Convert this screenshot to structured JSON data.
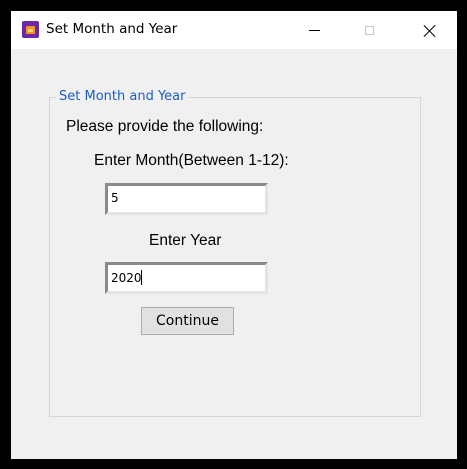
{
  "window": {
    "title": "Set Month and Year",
    "app_icon": "app-icon",
    "controls": {
      "minimize_icon": "minimize-icon",
      "maximize_icon": "maximize-icon",
      "close_icon": "close-icon"
    }
  },
  "form": {
    "group_title": "Set Month and Year",
    "intro_text": "Please provide the following:",
    "month_label": "Enter Month(Between 1-12):",
    "month_value": "5",
    "year_label": "Enter Year",
    "year_value": "2020",
    "continue_label": "Continue"
  },
  "colors": {
    "group_title": "#1a5dc9",
    "background": "#f0f0f0",
    "titlebar": "#ffffff"
  }
}
